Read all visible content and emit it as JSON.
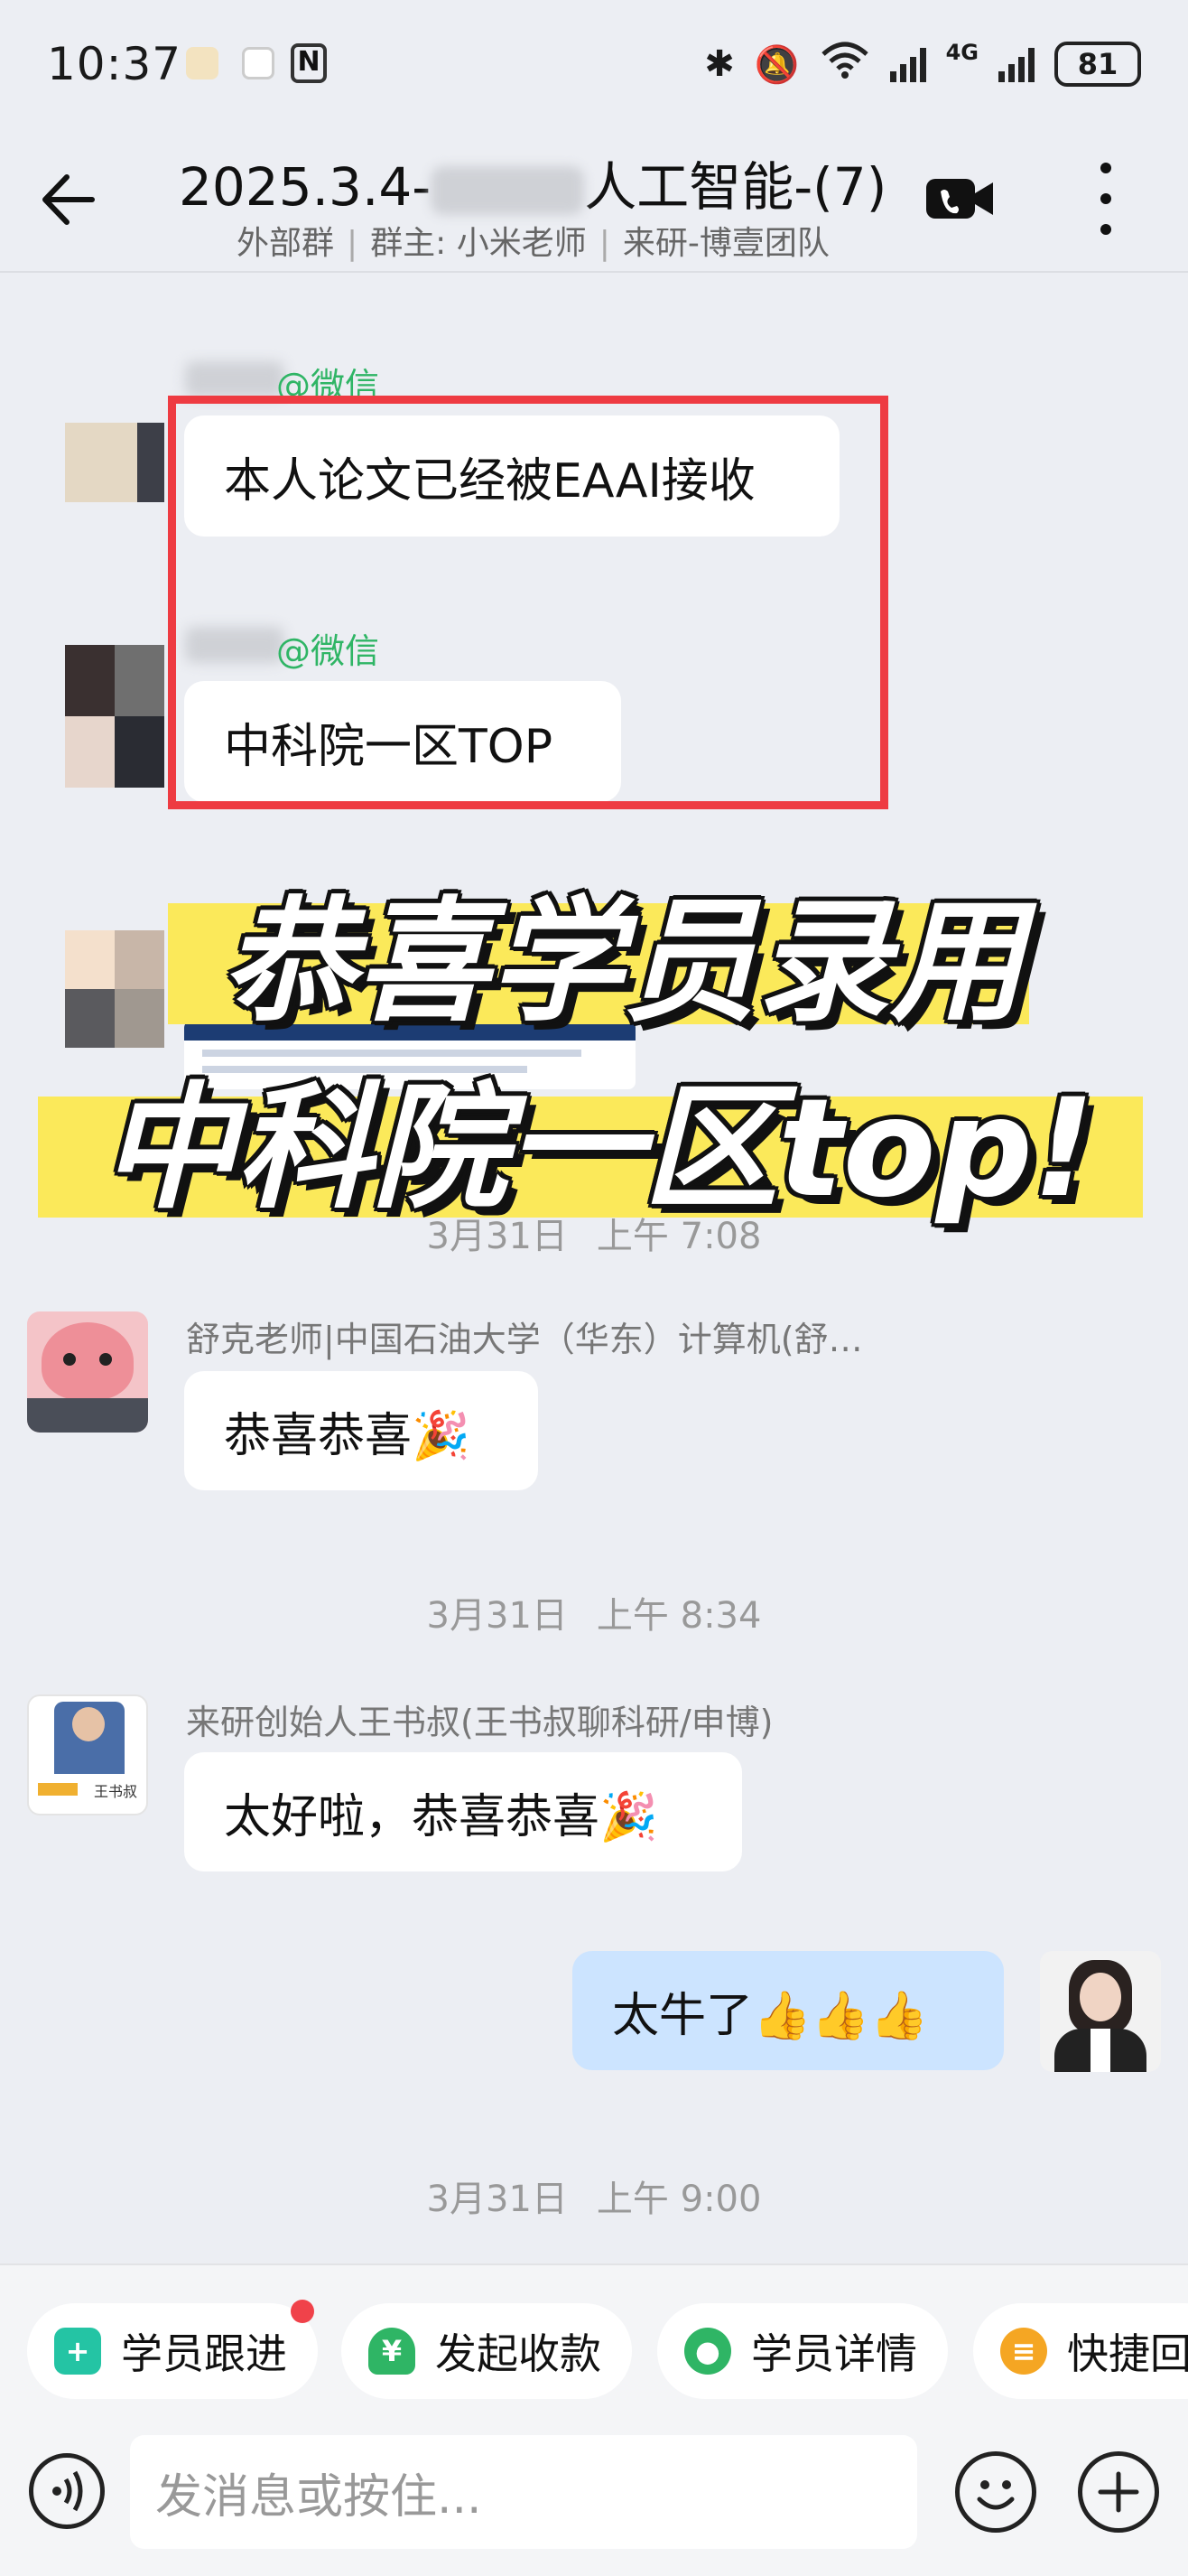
{
  "status_bar": {
    "time": "10:37",
    "network": "4G",
    "battery": "81"
  },
  "header": {
    "title_prefix": "2025.3.4-",
    "title_suffix": "人工智能",
    "title_count": "-(7)",
    "subtitle_tag": "外部群",
    "subtitle_owner": "群主: 小米老师",
    "subtitle_team": "来研-博壹团队"
  },
  "messages": {
    "m1": {
      "sender_suffix": "@微信",
      "text": "本人论文已经被EAAI接收"
    },
    "m2": {
      "sender_suffix": "@微信",
      "text": "中科院一区TOP"
    },
    "ts1": {
      "date": "3月31日",
      "time": "上午 7:08"
    },
    "m4": {
      "sender": "舒克老师|中国石油大学（华东）计算机(舒…",
      "text": "恭喜恭喜🎉"
    },
    "ts2": {
      "date": "3月31日",
      "time": "上午 8:34"
    },
    "m5": {
      "sender": "来研创始人王书叔(王书叔聊科研/申博)",
      "text": "太好啦，恭喜恭喜🎉",
      "avatar_caption": "王书叔"
    },
    "m6": {
      "text": "太牛了👍👍👍"
    },
    "ts3": {
      "date": "3月31日",
      "time": "上午 9:00"
    }
  },
  "banner": {
    "line1": "恭喜学员录用",
    "line2": "中科院一区top!"
  },
  "quick_actions": [
    {
      "label": "学员跟进",
      "icon": "student-follow-icon",
      "color": "#24c4a4"
    },
    {
      "label": "发起收款",
      "icon": "payment-icon",
      "color": "#2fb565"
    },
    {
      "label": "学员详情",
      "icon": "student-detail-icon",
      "color": "#2fb565"
    },
    {
      "label": "快捷回复",
      "icon": "quick-reply-icon",
      "color": "#f5a623"
    }
  ],
  "input": {
    "placeholder": "发消息或按住..."
  }
}
